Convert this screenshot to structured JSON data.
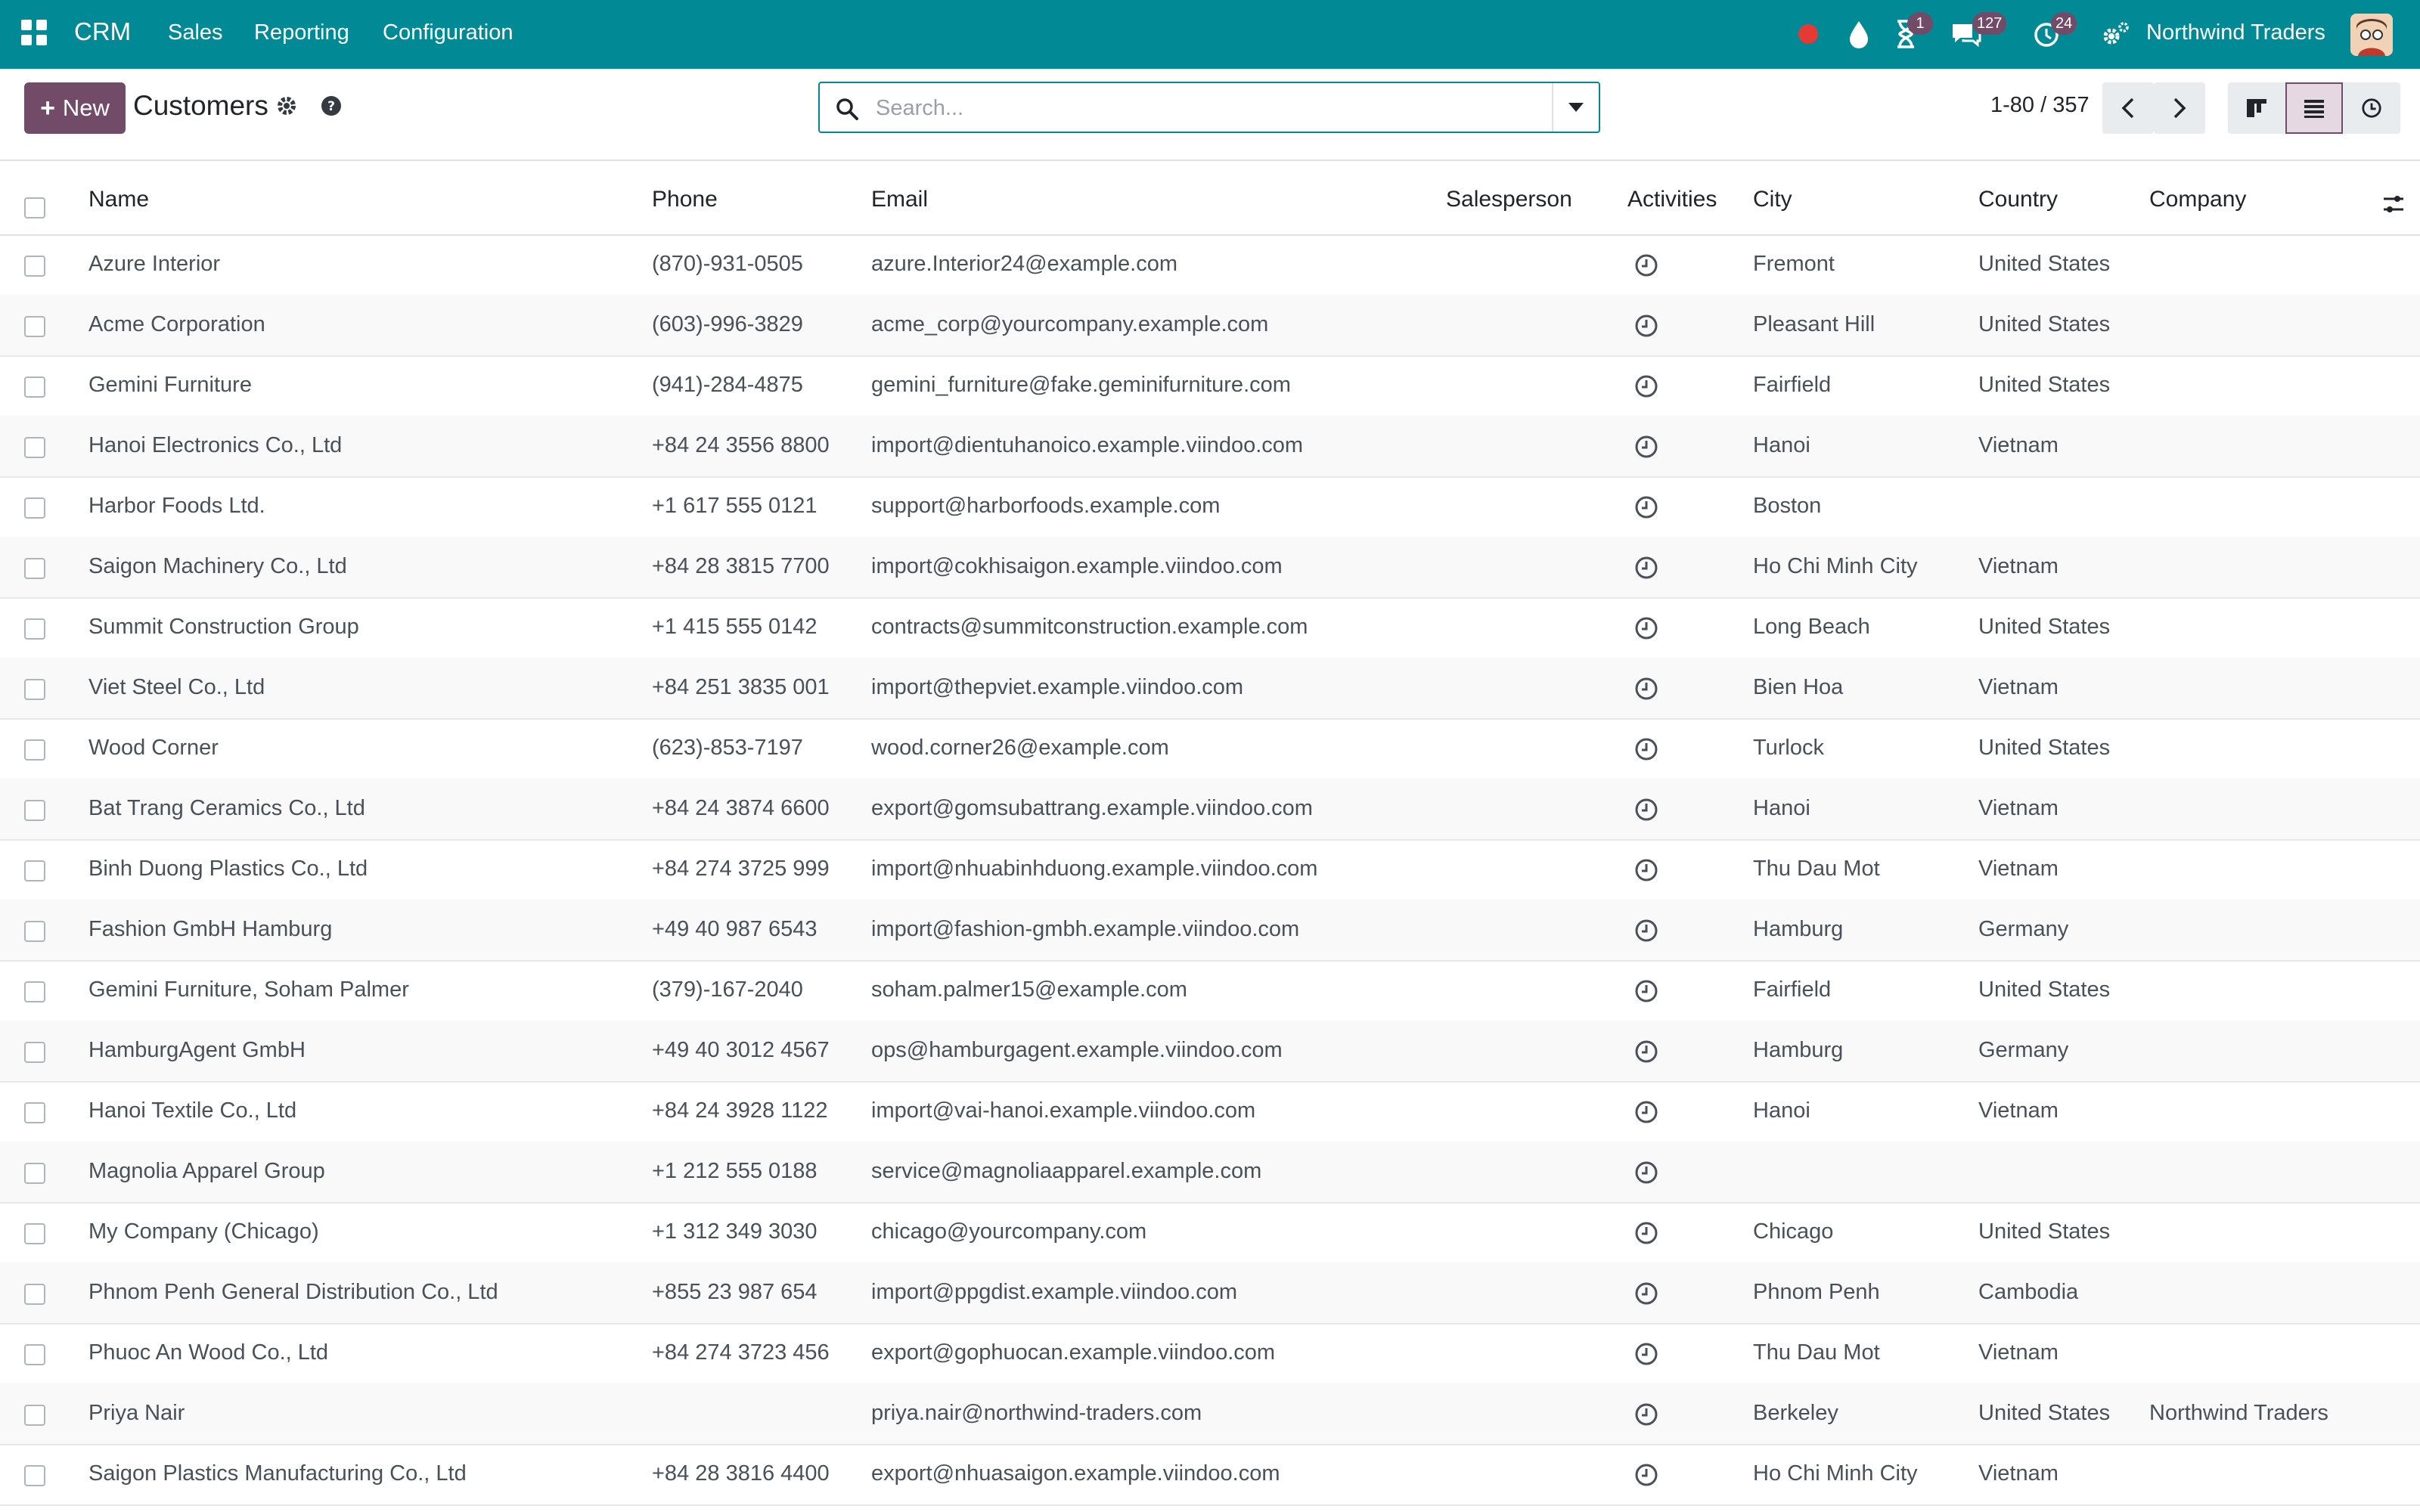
{
  "navbar": {
    "brand": "CRM",
    "menu": [
      "Sales",
      "Reporting",
      "Configuration"
    ],
    "activity_badge": "1",
    "messages_badge": "127",
    "schedule_badge": "24",
    "company": "Northwind Traders"
  },
  "control_panel": {
    "new_label": "New",
    "title": "Customers",
    "search_placeholder": "Search...",
    "pager": "1-80 / 357"
  },
  "table": {
    "columns": [
      "Name",
      "Phone",
      "Email",
      "Salesperson",
      "Activities",
      "City",
      "Country",
      "Company"
    ],
    "rows": [
      {
        "name": "Azure Interior",
        "phone": "(870)-931-0505",
        "email": "azure.Interior24@example.com",
        "salesperson": "",
        "city": "Fremont",
        "country": "United States",
        "company": ""
      },
      {
        "name": "Acme Corporation",
        "phone": "(603)-996-3829",
        "email": "acme_corp@yourcompany.example.com",
        "salesperson": "",
        "city": "Pleasant Hill",
        "country": "United States",
        "company": ""
      },
      {
        "name": "Gemini Furniture",
        "phone": "(941)-284-4875",
        "email": "gemini_furniture@fake.geminifurniture.com",
        "salesperson": "",
        "city": "Fairfield",
        "country": "United States",
        "company": ""
      },
      {
        "name": "Hanoi Electronics Co., Ltd",
        "phone": "+84 24 3556 8800",
        "email": "import@dientuhanoico.example.viindoo.com",
        "salesperson": "",
        "city": "Hanoi",
        "country": "Vietnam",
        "company": ""
      },
      {
        "name": "Harbor Foods Ltd.",
        "phone": "+1 617 555 0121",
        "email": "support@harborfoods.example.com",
        "salesperson": "",
        "city": "Boston",
        "country": "",
        "company": ""
      },
      {
        "name": "Saigon Machinery Co., Ltd",
        "phone": "+84 28 3815 7700",
        "email": "import@cokhisaigon.example.viindoo.com",
        "salesperson": "",
        "city": "Ho Chi Minh City",
        "country": "Vietnam",
        "company": ""
      },
      {
        "name": "Summit Construction Group",
        "phone": "+1 415 555 0142",
        "email": "contracts@summitconstruction.example.com",
        "salesperson": "",
        "city": "Long Beach",
        "country": "United States",
        "company": ""
      },
      {
        "name": "Viet Steel Co., Ltd",
        "phone": "+84 251 3835 001",
        "email": "import@thepviet.example.viindoo.com",
        "salesperson": "",
        "city": "Bien Hoa",
        "country": "Vietnam",
        "company": ""
      },
      {
        "name": "Wood Corner",
        "phone": "(623)-853-7197",
        "email": "wood.corner26@example.com",
        "salesperson": "",
        "city": "Turlock",
        "country": "United States",
        "company": ""
      },
      {
        "name": "Bat Trang Ceramics Co., Ltd",
        "phone": "+84 24 3874 6600",
        "email": "export@gomsubattrang.example.viindoo.com",
        "salesperson": "",
        "city": "Hanoi",
        "country": "Vietnam",
        "company": ""
      },
      {
        "name": "Binh Duong Plastics Co., Ltd",
        "phone": "+84 274 3725 999",
        "email": "import@nhuabinhduong.example.viindoo.com",
        "salesperson": "",
        "city": "Thu Dau Mot",
        "country": "Vietnam",
        "company": ""
      },
      {
        "name": "Fashion GmbH Hamburg",
        "phone": "+49 40 987 6543",
        "email": "import@fashion-gmbh.example.viindoo.com",
        "salesperson": "",
        "city": "Hamburg",
        "country": "Germany",
        "company": ""
      },
      {
        "name": "Gemini Furniture, Soham Palmer",
        "phone": "(379)-167-2040",
        "email": "soham.palmer15@example.com",
        "salesperson": "",
        "city": "Fairfield",
        "country": "United States",
        "company": ""
      },
      {
        "name": "HamburgAgent GmbH",
        "phone": "+49 40 3012 4567",
        "email": "ops@hamburgagent.example.viindoo.com",
        "salesperson": "",
        "city": "Hamburg",
        "country": "Germany",
        "company": ""
      },
      {
        "name": "Hanoi Textile Co., Ltd",
        "phone": "+84 24 3928 1122",
        "email": "import@vai-hanoi.example.viindoo.com",
        "salesperson": "",
        "city": "Hanoi",
        "country": "Vietnam",
        "company": ""
      },
      {
        "name": "Magnolia Apparel Group",
        "phone": "+1 212 555 0188",
        "email": "service@magnoliaapparel.example.com",
        "salesperson": "",
        "city": "",
        "country": "",
        "company": ""
      },
      {
        "name": "My Company (Chicago)",
        "phone": "+1 312 349 3030",
        "email": "chicago@yourcompany.com",
        "salesperson": "",
        "city": "Chicago",
        "country": "United States",
        "company": ""
      },
      {
        "name": "Phnom Penh General Distribution Co., Ltd",
        "phone": "+855 23 987 654",
        "email": "import@ppgdist.example.viindoo.com",
        "salesperson": "",
        "city": "Phnom Penh",
        "country": "Cambodia",
        "company": ""
      },
      {
        "name": "Phuoc An Wood Co., Ltd",
        "phone": "+84 274 3723 456",
        "email": "export@gophuocan.example.viindoo.com",
        "salesperson": "",
        "city": "Thu Dau Mot",
        "country": "Vietnam",
        "company": ""
      },
      {
        "name": "Priya Nair",
        "phone": "",
        "email": "priya.nair@northwind-traders.com",
        "salesperson": "",
        "city": "Berkeley",
        "country": "United States",
        "company": "Northwind Traders"
      },
      {
        "name": "Saigon Plastics Manufacturing Co., Ltd",
        "phone": "+84 28 3816 4400",
        "email": "export@nhuasaigon.example.viindoo.com",
        "salesperson": "",
        "city": "Ho Chi Minh City",
        "country": "Vietnam",
        "company": ""
      }
    ]
  },
  "colors": {
    "navbar": "#018a96",
    "primary": "#714b67",
    "status_dot": "#e53935"
  },
  "icons": {
    "apps": "apps-grid-icon",
    "status": "status-dot-icon",
    "droplet": "droplet-icon",
    "activity": "hourglass-icon",
    "messages": "chat-bubbles-icon",
    "schedule": "clock-refresh-icon",
    "settings": "gears-icon",
    "help": "question-circle-icon",
    "search": "search-icon",
    "row_activity": "clock-icon"
  }
}
